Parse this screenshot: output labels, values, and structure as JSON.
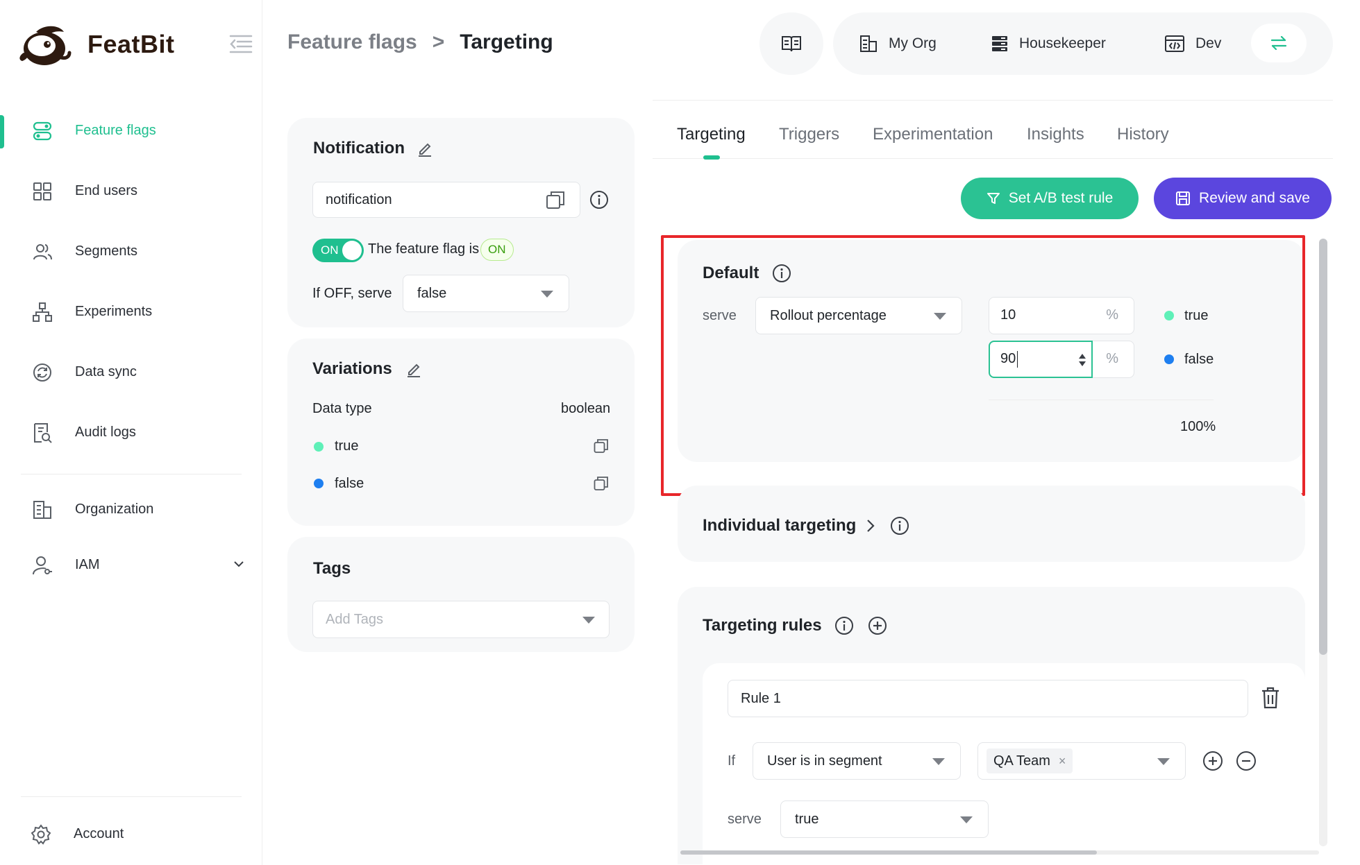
{
  "app": {
    "brand": "FeatBit",
    "brand_color": "#2d1a10",
    "accent_color": "#1fbf8f",
    "primary_color": "#5b46de",
    "highlight_color": "#e8262a"
  },
  "sidebar": {
    "items": [
      {
        "label": "Feature flags",
        "icon": "toggle-stack-icon",
        "active": true
      },
      {
        "label": "End users",
        "icon": "grid-icon"
      },
      {
        "label": "Segments",
        "icon": "users-icon"
      },
      {
        "label": "Experiments",
        "icon": "hierarchy-icon"
      },
      {
        "label": "Data sync",
        "icon": "sync-icon"
      },
      {
        "label": "Audit logs",
        "icon": "audit-log-icon"
      },
      {
        "label": "Organization",
        "icon": "building-icon"
      },
      {
        "label": "IAM",
        "icon": "user-key-icon"
      }
    ],
    "account": {
      "label": "Account",
      "icon": "gear-icon"
    }
  },
  "header": {
    "breadcrumb": {
      "parent": "Feature flags",
      "separator": ">",
      "current": "Targeting"
    },
    "context": {
      "org": "My Org",
      "project": "Housekeeper",
      "env": "Dev"
    }
  },
  "flag": {
    "notification": {
      "title": "Notification",
      "key": "notification",
      "toggle_label": "ON",
      "status_text": "The feature flag is",
      "status_badge": "ON",
      "off_serve_label": "If OFF, serve",
      "off_serve_value": "false"
    },
    "variations": {
      "title": "Variations",
      "data_type_label": "Data type",
      "data_type_value": "boolean",
      "items": [
        {
          "label": "true",
          "color": "#5ff0b8"
        },
        {
          "label": "false",
          "color": "#1e7ff0"
        }
      ]
    },
    "tags": {
      "title": "Tags",
      "placeholder": "Add Tags"
    }
  },
  "tabs": [
    "Targeting",
    "Triggers",
    "Experimentation",
    "Insights",
    "History"
  ],
  "actions": {
    "ab_test": "Set A/B test rule",
    "review_save": "Review and save"
  },
  "default_rule": {
    "title": "Default",
    "serve_label": "serve",
    "serve_mode": "Rollout percentage",
    "rollouts": [
      {
        "percent": "10",
        "unit": "%",
        "variation": "true",
        "color": "#5ff0b8"
      },
      {
        "percent": "90",
        "unit": "%",
        "variation": "false",
        "color": "#1e7ff0"
      }
    ],
    "total": "100%"
  },
  "individual_targeting": {
    "title": "Individual targeting"
  },
  "targeting_rules": {
    "title": "Targeting rules",
    "rules": [
      {
        "name": "Rule 1",
        "if_label": "If",
        "condition": "User is in segment",
        "segment": "QA Team",
        "serve_label": "serve",
        "serve_value": "true"
      }
    ]
  }
}
